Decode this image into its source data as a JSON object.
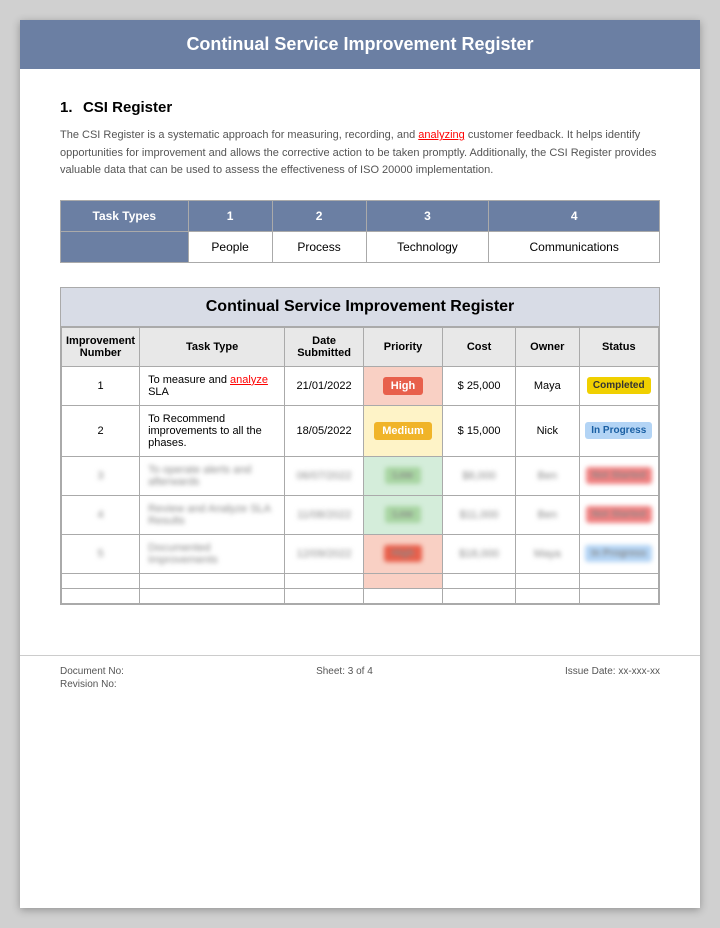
{
  "header": {
    "title": "Continual Service Improvement Register"
  },
  "section": {
    "number": "1.",
    "title": "CSI Register",
    "description": "The CSI Register is a systematic approach for measuring, recording, and analyzing customer feedback. It helps identify opportunities for improvement and allows the corrective action to be taken promptly. Additionally, the CSI Register provides valuable data that can be used to assess the effectiveness of ISO 20000 implementation.",
    "analyzing_word": "analyzing"
  },
  "task_types_table": {
    "header": {
      "col0": "Task Types",
      "col1": "1",
      "col2": "2",
      "col3": "3",
      "col4": "4"
    },
    "row": {
      "col0": "",
      "col1": "People",
      "col2": "Process",
      "col3": "Technology",
      "col4": "Communications"
    }
  },
  "csi_table": {
    "title": "Continual Service Improvement Register",
    "headers": {
      "improvement_number": "Improvement Number",
      "task_type": "Task Type",
      "date_submitted": "Date Submitted",
      "priority": "Priority",
      "cost": "Cost",
      "owner": "Owner",
      "status": "Status"
    },
    "rows": [
      {
        "number": "1",
        "task_type": "To measure and analyze SLA",
        "analyze_underline": true,
        "date": "21/01/2022",
        "priority": "High",
        "priority_class": "high",
        "cost": "$ 25,000",
        "owner": "Maya",
        "status": "Completed",
        "status_class": "completed"
      },
      {
        "number": "2",
        "task_type": "To Recommend improvements to all the phases.",
        "analyze_underline": false,
        "date": "18/05/2022",
        "priority": "Medium",
        "priority_class": "medium",
        "cost": "$ 15,000",
        "owner": "Nick",
        "status": "In Progress",
        "status_class": "inprogress"
      },
      {
        "number": "3",
        "task_type": "To operate alerts and afterwards",
        "analyze_underline": false,
        "date": "06/07/2022",
        "priority": "Low",
        "priority_class": "low",
        "cost": "$8,000",
        "owner": "Ben",
        "status": "Not Started",
        "status_class": "notstarted",
        "blurred": true
      },
      {
        "number": "4",
        "task_type": "Review and Analyze SLA Results",
        "analyze_underline": false,
        "date": "11/08/2022",
        "priority": "Low",
        "priority_class": "low",
        "cost": "$11,000",
        "owner": "Ben",
        "status": "Not Started",
        "status_class": "notstarted",
        "blurred": true
      },
      {
        "number": "5",
        "task_type": "Documented Improvements",
        "analyze_underline": false,
        "date": "12/09/2022",
        "priority": "High",
        "priority_class": "high",
        "cost": "$18,000",
        "owner": "Maya",
        "status": "In Progress",
        "status_class": "inprogress",
        "blurred": true
      },
      {
        "number": "",
        "task_type": "",
        "date": "",
        "priority": "",
        "priority_class": "high",
        "cost": "",
        "owner": "",
        "status": "",
        "status_class": "",
        "empty": true
      },
      {
        "number": "",
        "task_type": "",
        "date": "",
        "priority": "",
        "priority_class": "",
        "cost": "",
        "owner": "",
        "status": "",
        "status_class": "",
        "empty": true
      }
    ]
  },
  "footer": {
    "document_no_label": "Document No:",
    "revision_no_label": "Revision No:",
    "sheet_label": "Sheet: 3 of 4",
    "issue_date_label": "Issue Date: xx-xxx-xx"
  }
}
